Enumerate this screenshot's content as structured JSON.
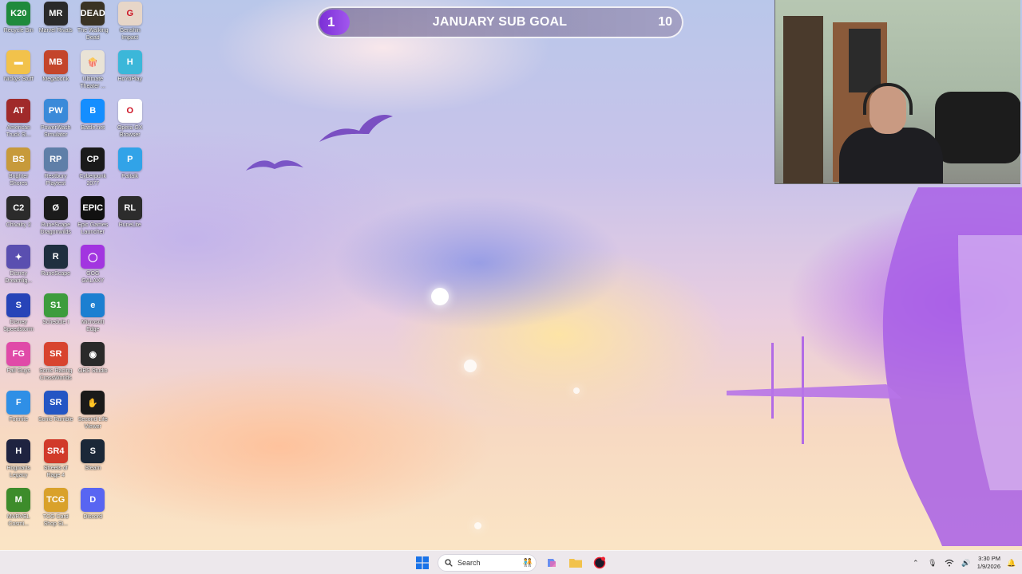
{
  "desktop": {
    "icons": [
      {
        "label": "Recycle Bin",
        "glyph": "K20",
        "color": "#1f8a3c",
        "icon": "recycle-bin-icon"
      },
      {
        "label": "Marvel Rivals",
        "glyph": "MR",
        "color": "#2a2a2a",
        "icon": "marvel-rivals-icon"
      },
      {
        "label": "The Walking Dead",
        "glyph": "DEAD",
        "color": "#3a3324",
        "icon": "walking-dead-icon"
      },
      {
        "label": "Genshin Impact",
        "glyph": "G",
        "color": "#e7d6c8",
        "icon": "genshin-impact-icon"
      },
      {
        "label": "Nickys Stuff",
        "glyph": "▬",
        "color": "#f2c24b",
        "icon": "folder-icon"
      },
      {
        "label": "Megabonk",
        "glyph": "MB",
        "color": "#c4452b",
        "icon": "megabonk-icon"
      },
      {
        "label": "Ultimate Theater ...",
        "glyph": "🍿",
        "color": "#e9e3d6",
        "icon": "ultimate-theater-icon"
      },
      {
        "label": "HoYoPlay",
        "glyph": "H",
        "color": "#3bb7d9",
        "icon": "hoyoplay-icon"
      },
      {
        "label": "American Truck Si...",
        "glyph": "AT",
        "color": "#a02a2a",
        "icon": "american-truck-icon"
      },
      {
        "label": "PowerWash Simulator",
        "glyph": "PW",
        "color": "#3a8ad9",
        "icon": "powerwash-icon"
      },
      {
        "label": "Battle.net",
        "glyph": "B",
        "color": "#148eff",
        "icon": "battlenet-icon"
      },
      {
        "label": "Opera GX Browser",
        "glyph": "O",
        "color": "#ffffff",
        "icon": "opera-gx-icon"
      },
      {
        "label": "Brighter Shores",
        "glyph": "BS",
        "color": "#c79a3b",
        "icon": "brighter-shores-icon"
      },
      {
        "label": "Restbury Playtest",
        "glyph": "RP",
        "color": "#5f7fa8",
        "icon": "restbury-icon"
      },
      {
        "label": "Cyberpunk 2077",
        "glyph": "CP",
        "color": "#1a1a1a",
        "icon": "cyberpunk-icon"
      },
      {
        "label": "Paltalk",
        "glyph": "P",
        "color": "#31a3e8",
        "icon": "paltalk-icon"
      },
      {
        "label": "Chivalry 2",
        "glyph": "C2",
        "color": "#2b2b2b",
        "icon": "chivalry-icon"
      },
      {
        "label": "RuneScape Dragonwilds",
        "glyph": "Ø",
        "color": "#1b1b1b",
        "icon": "runescape-dragonwilds-icon"
      },
      {
        "label": "Epic Games Launcher",
        "glyph": "EPIC",
        "color": "#111111",
        "icon": "epic-games-icon"
      },
      {
        "label": "RuneLite",
        "glyph": "RL",
        "color": "#2c2c2c",
        "icon": "runelite-icon"
      },
      {
        "label": "Disney Dreamlig...",
        "glyph": "✦",
        "color": "#5a4fb0",
        "icon": "disney-dreamlight-icon"
      },
      {
        "label": "RuneScape",
        "glyph": "R",
        "color": "#1f2f3f",
        "icon": "runescape-icon"
      },
      {
        "label": "GOG GALAXY",
        "glyph": "◯",
        "color": "#a235e0",
        "icon": "gog-galaxy-icon"
      },
      {
        "label": "",
        "glyph": "",
        "color": "",
        "icon": ""
      },
      {
        "label": "Disney Speedstorm",
        "glyph": "S",
        "color": "#2744b8",
        "icon": "disney-speedstorm-icon"
      },
      {
        "label": "Schedule I",
        "glyph": "S1",
        "color": "#3d9c3d",
        "icon": "schedule-one-icon"
      },
      {
        "label": "Microsoft Edge",
        "glyph": "e",
        "color": "#1c7fd1",
        "icon": "edge-icon"
      },
      {
        "label": "",
        "glyph": "",
        "color": "",
        "icon": ""
      },
      {
        "label": "Fall Guys",
        "glyph": "FG",
        "color": "#e04aa8",
        "icon": "fall-guys-icon"
      },
      {
        "label": "Sonic Racing CrossWorlds",
        "glyph": "SR",
        "color": "#d8442f",
        "icon": "sonic-racing-icon"
      },
      {
        "label": "OBS Studio",
        "glyph": "◉",
        "color": "#2a2a2a",
        "icon": "obs-studio-icon"
      },
      {
        "label": "",
        "glyph": "",
        "color": "",
        "icon": ""
      },
      {
        "label": "Fortnite",
        "glyph": "F",
        "color": "#2f8fe6",
        "icon": "fortnite-icon"
      },
      {
        "label": "Sonic Rumble",
        "glyph": "SR",
        "color": "#2456c4",
        "icon": "sonic-rumble-icon"
      },
      {
        "label": "Second Life Viewer",
        "glyph": "✋",
        "color": "#1a1a1a",
        "icon": "second-life-icon"
      },
      {
        "label": "",
        "glyph": "",
        "color": "",
        "icon": ""
      },
      {
        "label": "Hogwarts Legacy",
        "glyph": "H",
        "color": "#1f2340",
        "icon": "hogwarts-legacy-icon"
      },
      {
        "label": "Streets of Rage 4",
        "glyph": "SR4",
        "color": "#d13a2a",
        "icon": "streets-of-rage-icon"
      },
      {
        "label": "Steam",
        "glyph": "S",
        "color": "#1b2838",
        "icon": "steam-icon"
      },
      {
        "label": "",
        "glyph": "",
        "color": "",
        "icon": ""
      },
      {
        "label": "MARVEL Cosmi...",
        "glyph": "M",
        "color": "#3d8c2b",
        "icon": "marvel-cosmic-icon"
      },
      {
        "label": "TCG Card Shop Si...",
        "glyph": "TCG",
        "color": "#d9a12a",
        "icon": "tcg-card-shop-icon"
      },
      {
        "label": "Discord",
        "glyph": "D",
        "color": "#5865f2",
        "icon": "discord-icon"
      }
    ]
  },
  "sub_goal": {
    "current": "1",
    "title": "JANUARY SUB GOAL",
    "target": "10",
    "progress": 0.1,
    "accent": "#8a3fe0"
  },
  "taskbar": {
    "search_label": "Search",
    "time": "3:30 PM",
    "date": "1/9/2026"
  }
}
